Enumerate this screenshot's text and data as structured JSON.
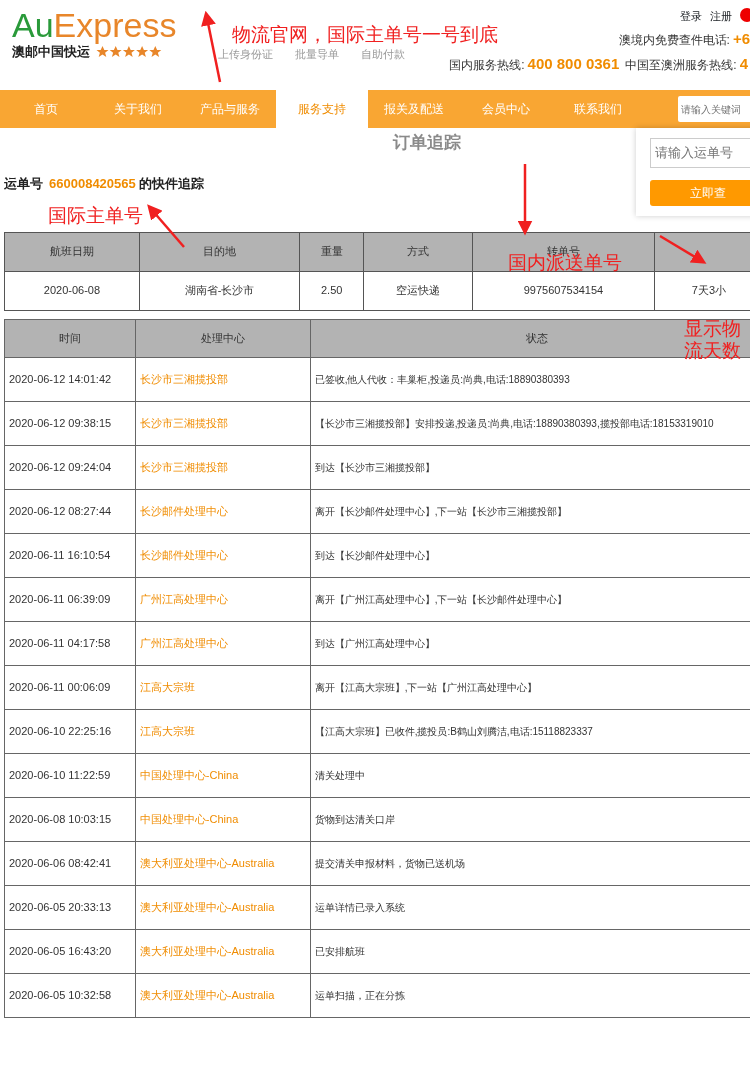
{
  "header": {
    "logo": {
      "part_1": "Au",
      "part_2": "Express",
      "subtitle": "澳邮中国快运"
    },
    "quick_links": [
      "上传身份证",
      "批量导单",
      "自助付款"
    ],
    "account_links": [
      "登录",
      "注册"
    ],
    "hotline_1": {
      "label": "澳境内免费查件电话:",
      "number": "+6"
    },
    "hotline_2": {
      "label": "国内服务热线:",
      "number": "400 800 0361"
    },
    "hotline_3": {
      "label": "中国至澳洲服务热线:",
      "number": "4"
    }
  },
  "nav": {
    "items": [
      {
        "label": "首页",
        "selected": false
      },
      {
        "label": "关于我们",
        "selected": false
      },
      {
        "label": "产品与服务",
        "selected": false
      },
      {
        "label": "服务支持",
        "selected": true
      },
      {
        "label": "报关及配送",
        "selected": false
      },
      {
        "label": "会员中心",
        "selected": false
      },
      {
        "label": "联系我们",
        "selected": false
      }
    ],
    "search": {
      "placeholder": "请输入关键词"
    }
  },
  "page_title": "订单追踪",
  "tracking_panel": {
    "placeholder": "请输入运单号",
    "button": "立即查"
  },
  "tracking": {
    "prefix": "运单号",
    "number": "660008420565",
    "suffix": "的快件追踪"
  },
  "info_table": {
    "columns": [
      "航班日期",
      "目的地",
      "重量",
      "方式",
      "转单号"
    ],
    "rows": [
      [
        "2020-06-08",
        "湖南省-长沙市",
        "2.50",
        "空运快递",
        "9975607534154",
        "7天3小"
      ]
    ]
  },
  "events_table": {
    "columns": [
      "时间",
      "处理中心",
      "状态"
    ],
    "rows": [
      [
        "2020-06-12 14:01:42",
        "长沙市三湘揽投部",
        "已签收,他人代收：丰巢柜,投递员:尚典,电话:18890380393"
      ],
      [
        "2020-06-12 09:38:15",
        "长沙市三湘揽投部",
        "【长沙市三湘揽投部】安排投递,投递员:尚典,电话:18890380393,揽投部电话:18153319010"
      ],
      [
        "2020-06-12 09:24:04",
        "长沙市三湘揽投部",
        "到达【长沙市三湘揽投部】"
      ],
      [
        "2020-06-12 08:27:44",
        "长沙邮件处理中心",
        "离开【长沙邮件处理中心】,下一站【长沙市三湘揽投部】"
      ],
      [
        "2020-06-11 16:10:54",
        "长沙邮件处理中心",
        "到达【长沙邮件处理中心】"
      ],
      [
        "2020-06-11 06:39:09",
        "广州江高处理中心",
        "离开【广州江高处理中心】,下一站【长沙邮件处理中心】"
      ],
      [
        "2020-06-11 04:17:58",
        "广州江高处理中心",
        "到达【广州江高处理中心】"
      ],
      [
        "2020-06-11 00:06:09",
        "江高大宗班",
        "离开【江高大宗班】,下一站【广州江高处理中心】"
      ],
      [
        "2020-06-10 22:25:16",
        "江高大宗班",
        "【江高大宗班】已收件,揽投员:B鹤山刘腾洁,电话:15118823337"
      ],
      [
        "2020-06-10 11:22:59",
        "中国处理中心-China",
        "清关处理中"
      ],
      [
        "2020-06-08 10:03:15",
        "中国处理中心-China",
        "货物到达清关口岸"
      ],
      [
        "2020-06-06 08:42:41",
        "澳大利亚处理中心-Australia",
        "提交清关申报材料，货物已送机场"
      ],
      [
        "2020-06-05 20:33:13",
        "澳大利亚处理中心-Australia",
        "运单详情已录入系统"
      ],
      [
        "2020-06-05 16:43:20",
        "澳大利亚处理中心-Australia",
        "已安排航班"
      ],
      [
        "2020-06-05 10:32:58",
        "澳大利亚处理中心-Australia",
        "运单扫描，正在分拣"
      ]
    ]
  },
  "annotations": [
    "物流官网，国际主单号一号到底",
    "国际主单号",
    "国内派送单号",
    "显示物流天数"
  ]
}
